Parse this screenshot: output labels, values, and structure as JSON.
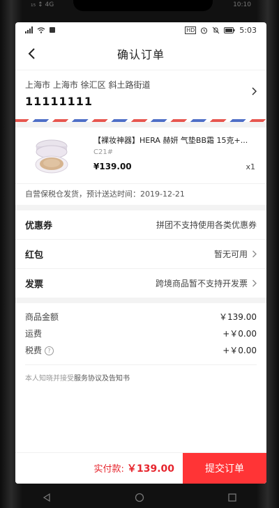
{
  "device_status": {
    "left": "₁₅ ↕ 4G",
    "right": "10:10"
  },
  "status": {
    "time": "5:03",
    "hd_label": "HD"
  },
  "nav": {
    "title": "确认订单"
  },
  "address": {
    "line": "上海市 上海市 徐汇区 斜土路街道",
    "phone": "11111111"
  },
  "product": {
    "name": "【裸妆神器】HERA 赫妍 气垫BB霜 15克+...",
    "spec": "C21#",
    "price": "¥139.00",
    "qty": "x1"
  },
  "shipping": "自营保税仓发货，预计送达时间：2019-12-21",
  "options": [
    {
      "label": "优惠券",
      "value": "拼团不支持使用各类优惠券"
    },
    {
      "label": "红包",
      "value": "暂无可用"
    },
    {
      "label": "发票",
      "value": "跨境商品暂不支持开发票"
    }
  ],
  "summary": [
    {
      "label": "商品金额",
      "value": "￥139.00"
    },
    {
      "label": "运费",
      "value": "+￥0.00"
    },
    {
      "label": "税费",
      "value": "+￥0.00",
      "help": "?"
    }
  ],
  "agreement": {
    "prefix": "本人知晓并接受",
    "link": "服务协议及告知书"
  },
  "bottom": {
    "pay_label": "实付款: ",
    "pay_amount": "￥139.00",
    "submit": "提交订单"
  },
  "colors": {
    "accent": "#ff3436",
    "price_red": "#e6262e"
  }
}
